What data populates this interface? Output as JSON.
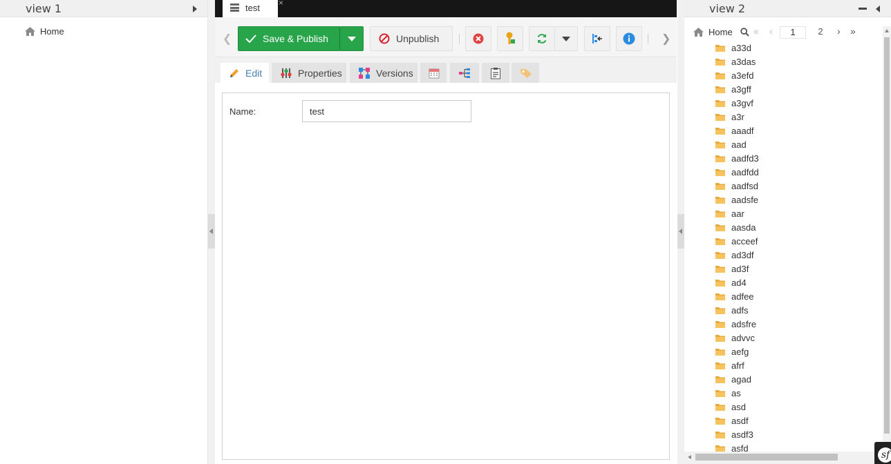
{
  "left_panel": {
    "title": "view 1",
    "tree_root": "Home"
  },
  "center": {
    "tab": {
      "label": "test",
      "close_glyph": "×"
    },
    "toolbar": {
      "save_publish_label": "Save & Publish",
      "unpublish_label": "Unpublish",
      "colors": {
        "save": "#28a54a",
        "delete": "#e04141",
        "reload": "#2fa84f",
        "info": "#2a8be0"
      }
    },
    "content_tabs": [
      {
        "label": "Edit",
        "icon": "pencil-icon"
      },
      {
        "label": "Properties",
        "icon": "properties-icon"
      },
      {
        "label": "Versions",
        "icon": "versions-icon"
      },
      {
        "label": "",
        "icon": "calendar-icon"
      },
      {
        "label": "",
        "icon": "dependencies-icon"
      },
      {
        "label": "",
        "icon": "notes-icon"
      },
      {
        "label": "",
        "icon": "tag-icon"
      }
    ],
    "form": {
      "name_label": "Name:",
      "name_value": "test"
    }
  },
  "right_panel": {
    "title": "view 2",
    "tree_root": "Home",
    "pager": {
      "current_page": "1",
      "total_pages": "2"
    },
    "folders": [
      "a33d",
      "a3das",
      "a3efd",
      "a3gff",
      "a3gvf",
      "a3r",
      "aaadf",
      "aad",
      "aadfd3",
      "aadfdd",
      "aadfsd",
      "aadsfe",
      "aar",
      "aasda",
      "acceef",
      "ad3df",
      "ad3f",
      "ad4",
      "adfee",
      "adfs",
      "adsfre",
      "advvc",
      "aefg",
      "afrf",
      "agad",
      "as",
      "asd",
      "asdf",
      "asdf3",
      "asfd"
    ]
  }
}
